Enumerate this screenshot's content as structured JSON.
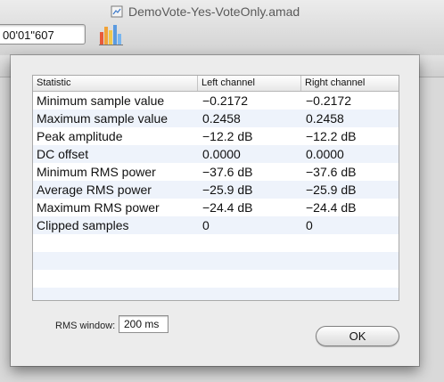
{
  "window": {
    "title": "DemoVote-Yes-VoteOnly.amad",
    "time_display": "00'01\"607"
  },
  "dialog": {
    "columns": [
      "Statistic",
      "Left channel",
      "Right channel"
    ],
    "rows": [
      [
        "Minimum sample value",
        "−0.2172",
        "−0.2172"
      ],
      [
        "Maximum sample value",
        "0.2458",
        "0.2458"
      ],
      [
        "Peak amplitude",
        "−12.2 dB",
        "−12.2 dB"
      ],
      [
        "DC offset",
        "0.0000",
        "0.0000"
      ],
      [
        "Minimum RMS power",
        "−37.6 dB",
        "−37.6 dB"
      ],
      [
        "Average RMS power",
        "−25.9 dB",
        "−25.9 dB"
      ],
      [
        "Maximum RMS power",
        "−24.4 dB",
        "−24.4 dB"
      ],
      [
        "Clipped samples",
        "0",
        "0"
      ]
    ],
    "rms_window_label": "RMS window:",
    "rms_window_value": "200 ms",
    "ok_label": "OK"
  },
  "icons": {
    "document": "document-icon",
    "statistics": "bar-chart-icon"
  }
}
